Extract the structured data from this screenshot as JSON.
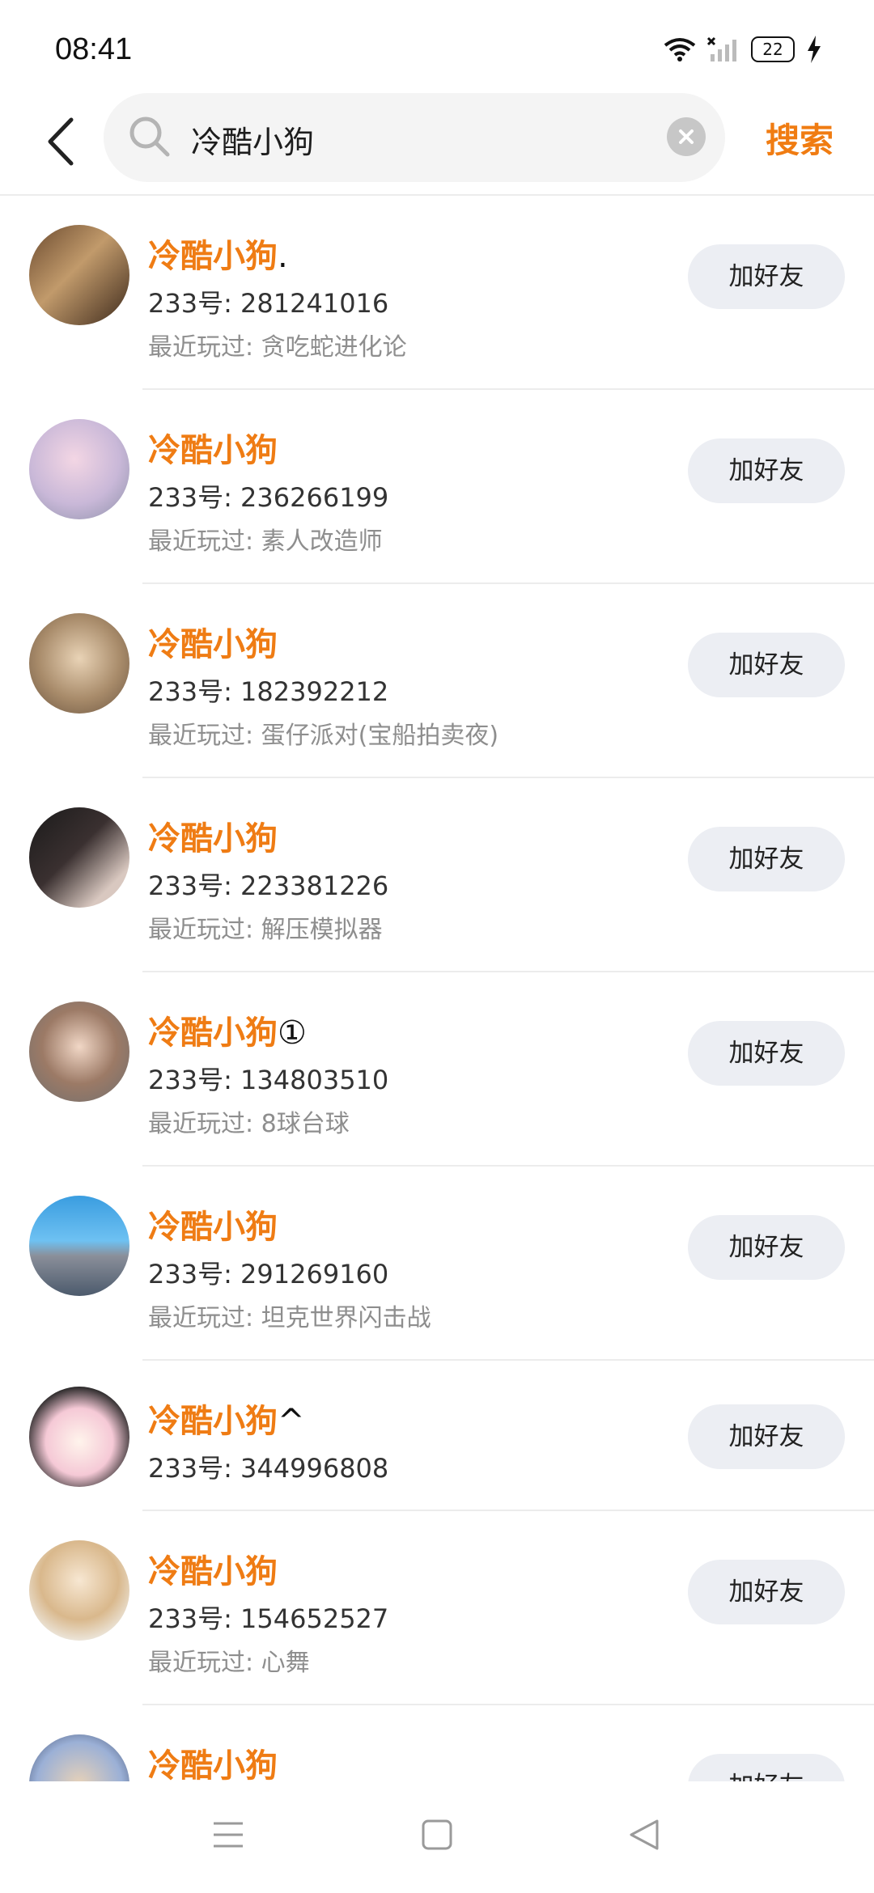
{
  "status_bar": {
    "time": "08:41",
    "battery": "22"
  },
  "search": {
    "query": "冷酷小狗",
    "button_label": "搜索"
  },
  "results": [
    {
      "name": "冷酷小狗",
      "suffix": ".",
      "uid": "233号: 281241016",
      "recent": "最近玩过: 贪吃蛇进化论",
      "button": "加好友",
      "avatar": "avatar-photo-girl-reading"
    },
    {
      "name": "冷酷小狗",
      "suffix": "",
      "uid": "233号: 236266199",
      "recent": "最近玩过: 素人改造师",
      "button": "加好友",
      "avatar": "avatar-anime-pink-hair"
    },
    {
      "name": "冷酷小狗",
      "suffix": "",
      "uid": "233号: 182392212",
      "recent": "最近玩过: 蛋仔派对(宝船拍卖夜)",
      "button": "加好友",
      "avatar": "avatar-anime-hat-girl"
    },
    {
      "name": "冷酷小狗",
      "suffix": "",
      "uid": "233号: 223381226",
      "recent": "最近玩过: 解压模拟器",
      "button": "加好友",
      "avatar": "avatar-dark-photo"
    },
    {
      "name": "冷酷小狗",
      "suffix": "①",
      "uid": "233号: 134803510",
      "recent": "最近玩过: 8球台球",
      "button": "加好友",
      "avatar": "avatar-3d-brown-hair-girl"
    },
    {
      "name": "冷酷小狗",
      "suffix": "",
      "uid": "233号: 291269160",
      "recent": "最近玩过: 坦克世界闪击战",
      "button": "加好友",
      "avatar": "avatar-cartoon-wall-sky"
    },
    {
      "name": "冷酷小狗",
      "suffix": "^",
      "uid": "233号: 344996808",
      "recent": "",
      "button": "加好友",
      "avatar": "avatar-chibi-bunny"
    },
    {
      "name": "冷酷小狗",
      "suffix": "",
      "uid": "233号: 154652527",
      "recent": "最近玩过: 心舞",
      "button": "加好友",
      "avatar": "avatar-fairy-girl"
    },
    {
      "name": "冷酷小狗",
      "suffix": "",
      "uid": "",
      "recent": "",
      "button": "加好友",
      "avatar": "avatar-partial-anime"
    }
  ],
  "colors": {
    "accent": "#ef7c14",
    "button_bg": "#eceef3",
    "divider": "#ececec"
  },
  "nav": {
    "icons": [
      "menu-icon",
      "home-square-icon",
      "back-triangle-icon"
    ]
  }
}
